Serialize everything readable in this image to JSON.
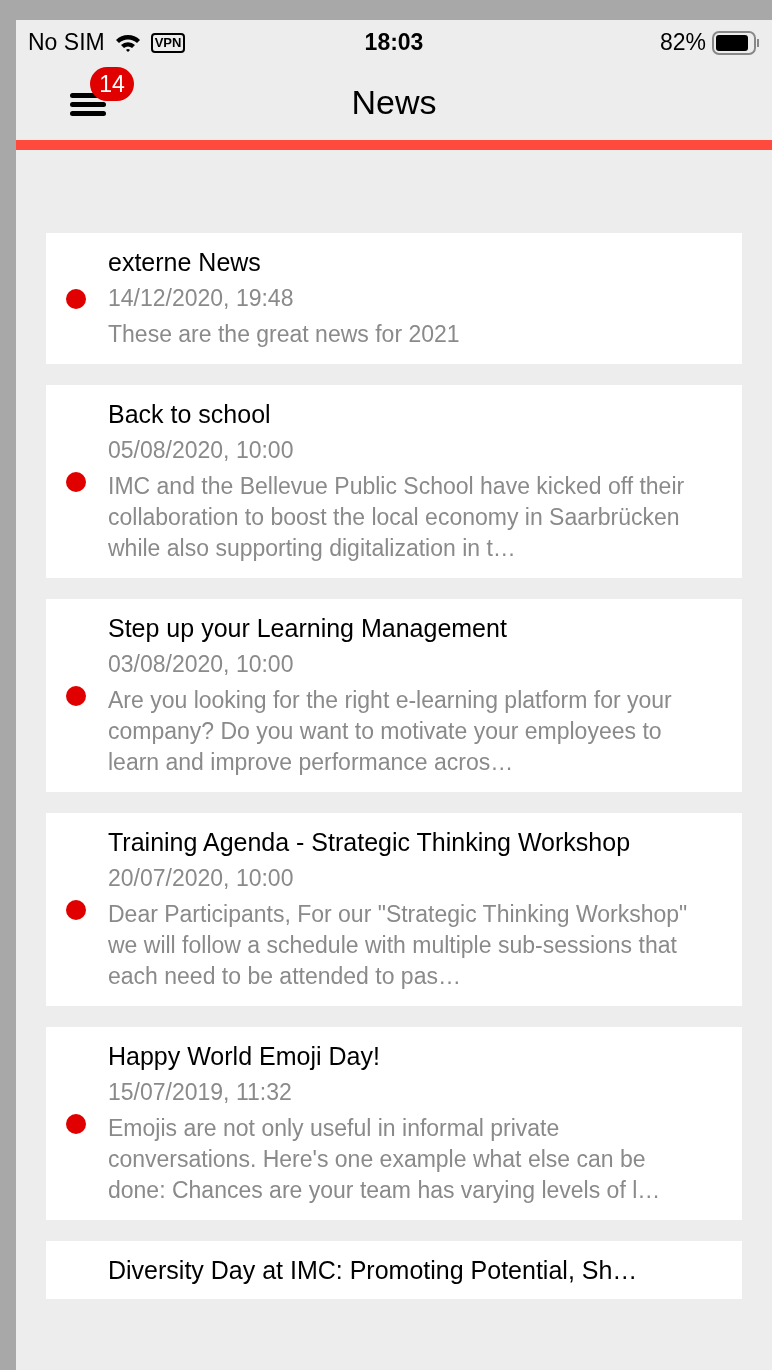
{
  "status_bar": {
    "carrier": "No SIM",
    "vpn": "VPN",
    "time": "18:03",
    "battery": "82%"
  },
  "header": {
    "title": "News",
    "badge": "14"
  },
  "news": [
    {
      "title": "externe News",
      "date": "14/12/2020, 19:48",
      "summary": "These are the great news for 2021",
      "unread": true
    },
    {
      "title": "Back to school",
      "date": "05/08/2020, 10:00",
      "summary": "IMC and the Bellevue Public School have kicked off their collaboration to boost the local economy in Saarbrücken while also supporting digitalization in t…",
      "unread": true
    },
    {
      "title": "Step up your Learning Management",
      "date": "03/08/2020, 10:00",
      "summary": "Are you looking for the right e-learning platform for your company? Do you want to motivate your employees to learn and improve performance acros…",
      "unread": true
    },
    {
      "title": "Training Agenda - Strategic Thinking Workshop",
      "date": "20/07/2020, 10:00",
      "summary": "Dear Participants, For our \"Strategic Thinking Workshop\" we will follow a schedule with multiple sub-sessions that each need to be attended to pas…",
      "unread": true
    },
    {
      "title": "Happy World Emoji Day!",
      "date": "15/07/2019, 11:32",
      "summary": "Emojis are not only useful in informal private conversations. Here's one example what else can be done: Chances are your team has varying levels of l…",
      "unread": true
    },
    {
      "title": "Diversity Day at IMC: Promoting Potential, Sh…"
    }
  ]
}
